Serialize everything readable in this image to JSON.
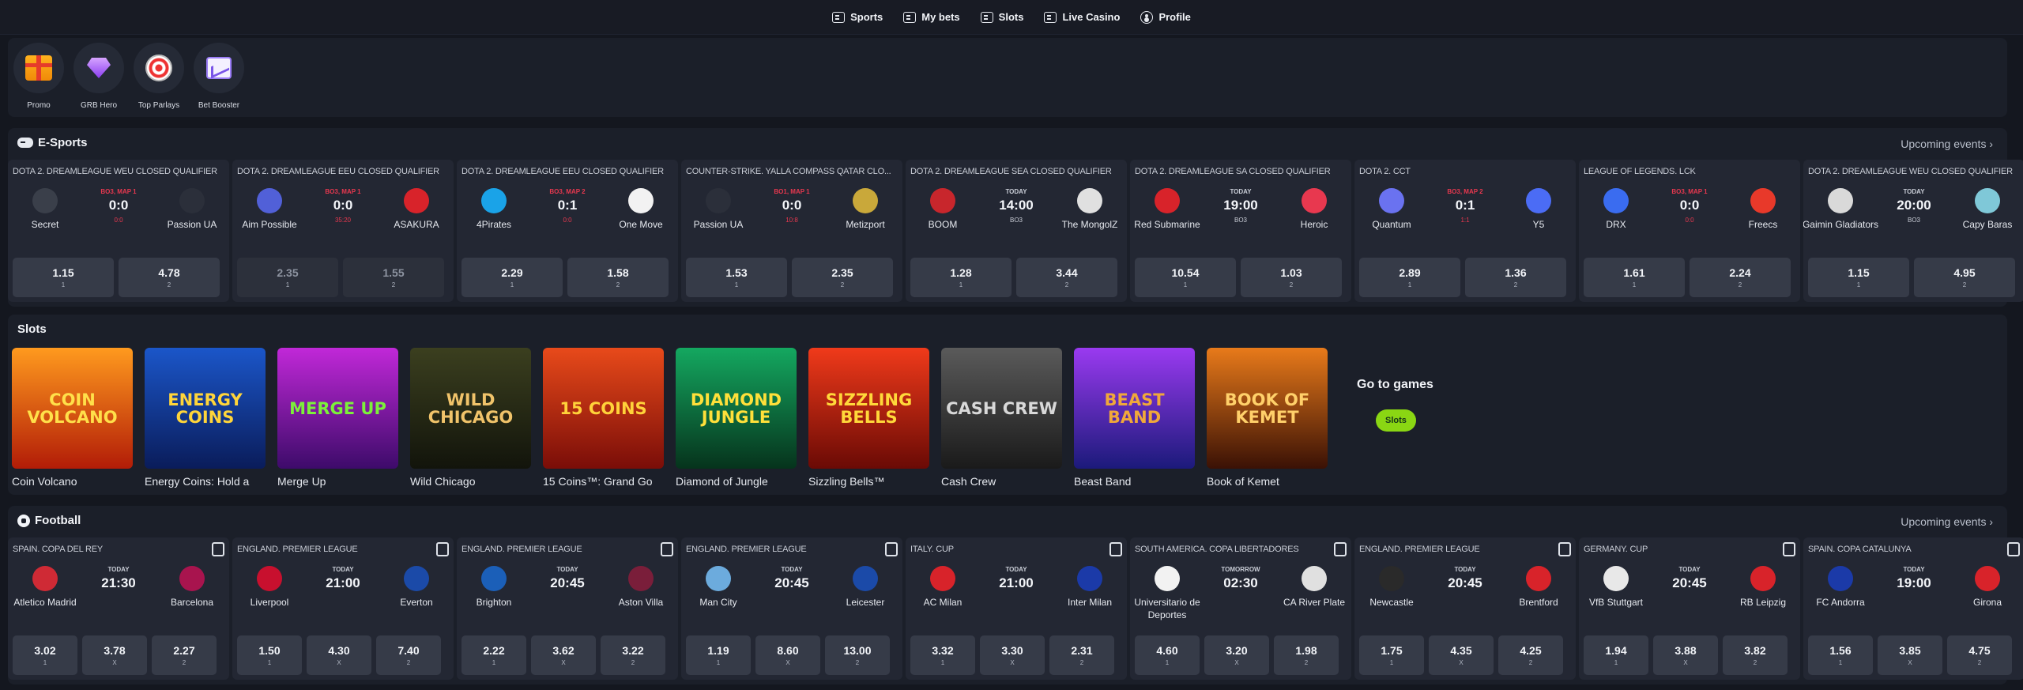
{
  "nav": [
    {
      "label": "Sports",
      "icon": "sports-icon"
    },
    {
      "label": "My bets",
      "icon": "ticket-icon"
    },
    {
      "label": "Slots",
      "icon": "slots-icon"
    },
    {
      "label": "Live Casino",
      "icon": "casino-icon"
    },
    {
      "label": "Profile",
      "icon": "profile-icon"
    }
  ],
  "quicklinks": [
    {
      "label": "Promo",
      "icon": "gift-icon"
    },
    {
      "label": "GRB Hero",
      "icon": "gem-icon"
    },
    {
      "label": "Top Parlays",
      "icon": "target-icon"
    },
    {
      "label": "Bet Booster",
      "icon": "chart-icon"
    }
  ],
  "esports": {
    "title": "E-Sports",
    "more": "Upcoming events ›",
    "cards": [
      {
        "league": "DOTA 2. DREAMLEAGUE WEU CLOSED QUALIFIER",
        "home": "Secret",
        "away": "Passion UA",
        "tag": "BO3, MAP 1",
        "score": "0:0",
        "sub": "0:0",
        "live": true,
        "odds": [
          "1.15",
          "4.78"
        ],
        "labels": [
          "1",
          "2"
        ],
        "c1": "#3a3f4a",
        "c2": "#2b2f3a",
        "dim": false
      },
      {
        "league": "DOTA 2. DREAMLEAGUE EEU CLOSED QUALIFIER",
        "home": "Aim Possible",
        "away": "ASAKURA",
        "tag": "BO3, MAP 1",
        "score": "0:0",
        "sub": "35:20",
        "live": true,
        "odds": [
          "2.35",
          "1.55"
        ],
        "labels": [
          "1",
          "2"
        ],
        "c1": "#5160d8",
        "c2": "#d8232a",
        "dim": true
      },
      {
        "league": "DOTA 2. DREAMLEAGUE EEU CLOSED QUALIFIER",
        "home": "4Pirates",
        "away": "One Move",
        "tag": "BO3, MAP 2",
        "score": "0:1",
        "sub": "0:0",
        "live": true,
        "odds": [
          "2.29",
          "1.58"
        ],
        "labels": [
          "1",
          "2"
        ],
        "c1": "#1aa3e8",
        "c2": "#f2f2f2",
        "dim": false
      },
      {
        "league": "COUNTER-STRIKE. YALLA COMPASS QATAR CLO...",
        "home": "Passion UA",
        "away": "Metizport",
        "tag": "BO1, MAP 1",
        "score": "0:0",
        "sub": "10:8",
        "live": true,
        "odds": [
          "1.53",
          "2.35"
        ],
        "labels": [
          "1",
          "2"
        ],
        "c1": "#2b2f3a",
        "c2": "#c9a83a",
        "dim": false
      },
      {
        "league": "DOTA 2. DREAMLEAGUE SEA CLOSED QUALIFIER",
        "home": "BOOM",
        "away": "The MongolZ",
        "tag": "TODAY",
        "score": "14:00",
        "sub": "BO3",
        "live": false,
        "odds": [
          "1.28",
          "3.44"
        ],
        "labels": [
          "1",
          "2"
        ],
        "c1": "#c8262c",
        "c2": "#e0e0e0",
        "dim": false
      },
      {
        "league": "DOTA 2. DREAMLEAGUE SA CLOSED QUALIFIER",
        "home": "Red Submarine",
        "away": "Heroic",
        "tag": "TODAY",
        "score": "19:00",
        "sub": "BO3",
        "live": false,
        "odds": [
          "10.54",
          "1.03"
        ],
        "labels": [
          "1",
          "2"
        ],
        "c1": "#d8232a",
        "c2": "#e8384f",
        "dim": false
      },
      {
        "league": "DOTA 2. CCT",
        "home": "Quantum",
        "away": "Y5",
        "tag": "BO3, MAP 2",
        "score": "0:1",
        "sub": "1:1",
        "live": true,
        "odds": [
          "2.89",
          "1.36"
        ],
        "labels": [
          "1",
          "2"
        ],
        "c1": "#6a72f0",
        "c2": "#4b6cf5",
        "dim": false
      },
      {
        "league": "LEAGUE OF LEGENDS. LCK",
        "home": "DRX",
        "away": "Freecs",
        "tag": "BO3, MAP 1",
        "score": "0:0",
        "sub": "0:0",
        "live": true,
        "odds": [
          "1.61",
          "2.24"
        ],
        "labels": [
          "1",
          "2"
        ],
        "c1": "#3a6cf0",
        "c2": "#e8392a",
        "dim": false
      },
      {
        "league": "DOTA 2. DREAMLEAGUE WEU CLOSED QUALIFIER",
        "home": "Gaimin Gladiators",
        "away": "Capy Baras",
        "tag": "TODAY",
        "score": "20:00",
        "sub": "BO3",
        "live": false,
        "odds": [
          "1.15",
          "4.95"
        ],
        "labels": [
          "1",
          "2"
        ],
        "c1": "#d9d9d9",
        "c2": "#7fc8d8",
        "dim": false
      }
    ]
  },
  "slots": {
    "title": "Slots",
    "games": [
      {
        "name": "Coin Volcano",
        "art": "COIN VOLCANO",
        "bg": "linear-gradient(#ff9a1e,#b21c07)",
        "fg": "#ffe04a"
      },
      {
        "name": "Energy Coins: Hold a",
        "art": "ENERGY COINS",
        "bg": "linear-gradient(#1b56c9,#0a1c5a)",
        "fg": "#ffd53a"
      },
      {
        "name": "Merge Up",
        "art": "MERGE UP",
        "bg": "linear-gradient(#c128d8,#3d0b6a)",
        "fg": "#7cf03a"
      },
      {
        "name": "Wild Chicago",
        "art": "WILD CHICAGO",
        "bg": "linear-gradient(#3b3f1f,#12140b)",
        "fg": "#f0c36a"
      },
      {
        "name": "15 Coins™: Grand Go",
        "art": "15 COINS",
        "bg": "linear-gradient(#e84a1a,#7a0d08)",
        "fg": "#ffd23a"
      },
      {
        "name": "Diamond of Jungle",
        "art": "DIAMOND JUNGLE",
        "bg": "linear-gradient(#14a860,#06331c)",
        "fg": "#ffe03a"
      },
      {
        "name": "Sizzling Bells™",
        "art": "SIZZLING BELLS",
        "bg": "linear-gradient(#f03a1a,#6a0a05)",
        "fg": "#ffd83a"
      },
      {
        "name": "Cash Crew",
        "art": "CASH CREW",
        "bg": "linear-gradient(#5a5a5a,#1a1a1a)",
        "fg": "#d8d8d8"
      },
      {
        "name": "Beast Band",
        "art": "BEAST BAND",
        "bg": "linear-gradient(#9a3af0,#1b1a7a)",
        "fg": "#f0a83a"
      },
      {
        "name": "Book of Kemet",
        "art": "BOOK OF KEMET",
        "bg": "linear-gradient(#e87a1a,#3a1105)",
        "fg": "#ffd06a"
      }
    ],
    "goto_title": "Go to games",
    "goto_button": "Slots"
  },
  "football": {
    "title": "Football",
    "more": "Upcoming events ›",
    "cards": [
      {
        "league": "SPAIN. COPA DEL REY",
        "home": "Atletico Madrid",
        "away": "Barcelona",
        "tag": "TODAY",
        "time": "21:30",
        "odds": [
          "3.02",
          "3.78",
          "2.27"
        ],
        "labels": [
          "1",
          "X",
          "2"
        ],
        "c1": "#cf2a35",
        "c2": "#a8144e"
      },
      {
        "league": "ENGLAND. PREMIER LEAGUE",
        "home": "Liverpool",
        "away": "Everton",
        "tag": "TODAY",
        "time": "21:00",
        "odds": [
          "1.50",
          "4.30",
          "7.40"
        ],
        "labels": [
          "1",
          "X",
          "2"
        ],
        "c1": "#c8102e",
        "c2": "#1b4aa8"
      },
      {
        "league": "ENGLAND. PREMIER LEAGUE",
        "home": "Brighton",
        "away": "Aston Villa",
        "tag": "TODAY",
        "time": "20:45",
        "odds": [
          "2.22",
          "3.62",
          "3.22"
        ],
        "labels": [
          "1",
          "X",
          "2"
        ],
        "c1": "#1b5fb8",
        "c2": "#7a1e3a"
      },
      {
        "league": "ENGLAND. PREMIER LEAGUE",
        "home": "Man City",
        "away": "Leicester",
        "tag": "TODAY",
        "time": "20:45",
        "odds": [
          "1.19",
          "8.60",
          "13.00"
        ],
        "labels": [
          "1",
          "X",
          "2"
        ],
        "c1": "#6cabdd",
        "c2": "#1b4aa8"
      },
      {
        "league": "ITALY. CUP",
        "home": "AC Milan",
        "away": "Inter Milan",
        "tag": "TODAY",
        "time": "21:00",
        "odds": [
          "3.32",
          "3.30",
          "2.31"
        ],
        "labels": [
          "1",
          "X",
          "2"
        ],
        "c1": "#d8232a",
        "c2": "#1b3aa8"
      },
      {
        "league": "SOUTH AMERICA. COPA LIBERTADORES",
        "home": "Universitario de Deportes",
        "away": "CA River Plate",
        "tag": "TOMORROW",
        "time": "02:30",
        "odds": [
          "4.60",
          "3.20",
          "1.98"
        ],
        "labels": [
          "1",
          "X",
          "2"
        ],
        "c1": "#f2f2f2",
        "c2": "#e0e0e0"
      },
      {
        "league": "ENGLAND. PREMIER LEAGUE",
        "home": "Newcastle",
        "away": "Brentford",
        "tag": "TODAY",
        "time": "20:45",
        "odds": [
          "1.75",
          "4.35",
          "4.25"
        ],
        "labels": [
          "1",
          "X",
          "2"
        ],
        "c1": "#2a2a2a",
        "c2": "#d8232a"
      },
      {
        "league": "GERMANY. CUP",
        "home": "VfB Stuttgart",
        "away": "RB Leipzig",
        "tag": "TODAY",
        "time": "20:45",
        "odds": [
          "1.94",
          "3.88",
          "3.82"
        ],
        "labels": [
          "1",
          "X",
          "2"
        ],
        "c1": "#e8e8e8",
        "c2": "#d8232a"
      },
      {
        "league": "SPAIN. COPA CATALUNYA",
        "home": "FC Andorra",
        "away": "Girona",
        "tag": "TODAY",
        "time": "19:00",
        "odds": [
          "1.56",
          "3.85",
          "4.75"
        ],
        "labels": [
          "1",
          "X",
          "2"
        ],
        "c1": "#1b3aa8",
        "c2": "#d8232a"
      }
    ]
  }
}
